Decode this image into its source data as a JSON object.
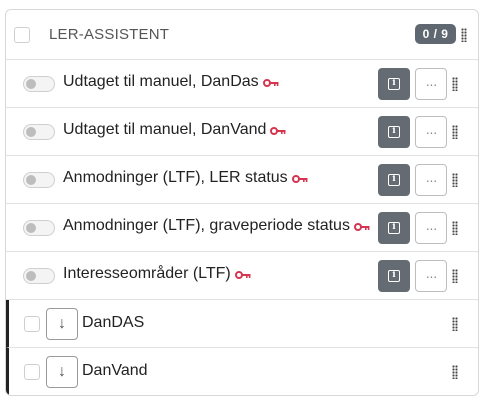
{
  "header": {
    "title": "LER-ASSISTENT",
    "count": "0 / 9"
  },
  "items": [
    {
      "label": "Udtaget til manuel, DanDas",
      "icon": "key-icon"
    },
    {
      "label": "Udtaget til manuel, DanVand",
      "icon": "key-icon"
    },
    {
      "label": "Anmodninger (LTF), LER status",
      "icon": "key-icon"
    },
    {
      "label": "Anmodninger (LTF), graveperiode status",
      "icon": "key-icon"
    },
    {
      "label": "Interesseområder (LTF)",
      "icon": "key-icon"
    }
  ],
  "sub_items": [
    {
      "label": "DanDAS"
    },
    {
      "label": "DanVand"
    }
  ],
  "buttons": {
    "more_glyph": "···",
    "arrow_glyph": "↓",
    "info_glyph": "i"
  },
  "colors": {
    "key_accent": "#d6344f",
    "info_button_bg": "#646b72",
    "badge_bg": "#5f6770"
  }
}
